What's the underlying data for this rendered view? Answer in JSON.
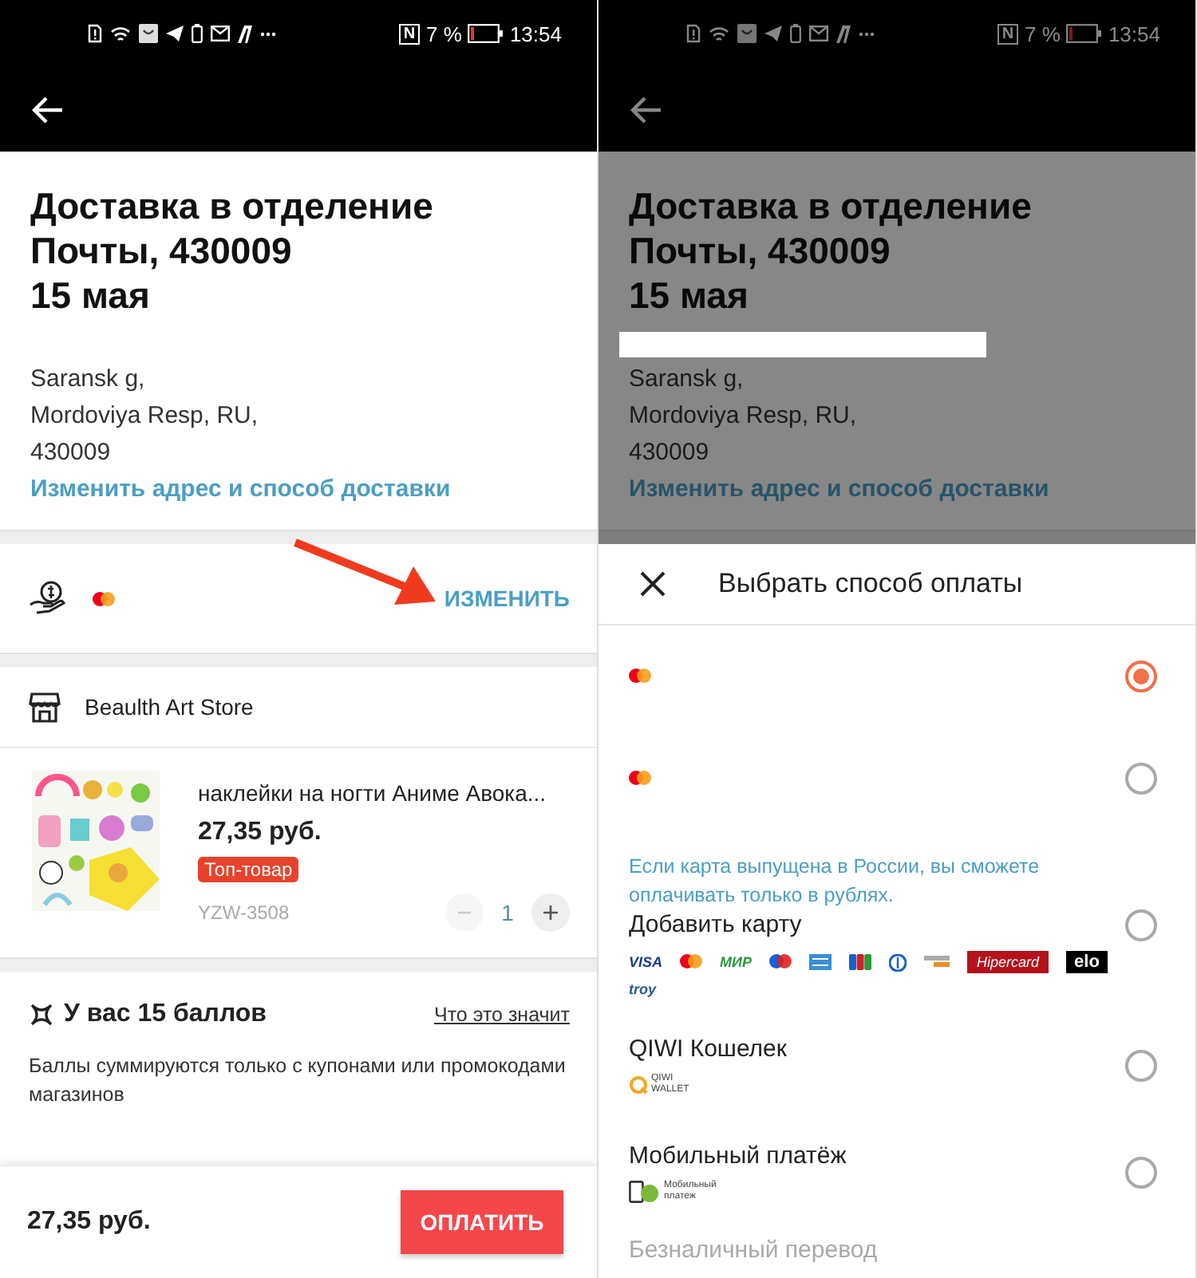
{
  "screens": [
    {
      "status_bar": {
        "nfc": "N",
        "battery": "7 %",
        "time": "13:54"
      },
      "delivery": {
        "title_lines": [
          "Доставка в отделение",
          "Почты, 430009"
        ],
        "date": "15 мая",
        "address": [
          "Saransk g,",
          "Mordoviya Resp, RU,",
          "430009"
        ],
        "change_link": "Изменить адрес и способ доставки"
      },
      "payment": {
        "change_button": "ИЗМЕНИТЬ"
      },
      "store": {
        "name": "Beaulth Art Store"
      },
      "product": {
        "name": "наклейки на ногти Аниме Авока...",
        "price": "27,35 руб.",
        "badge": "Топ-товар",
        "sku": "YZW-3508",
        "quantity": "1"
      },
      "points": {
        "title": "У вас 15 баллов",
        "link": "Что это значит",
        "note": "Баллы суммируются только с купонами или промокодами магазинов"
      },
      "footer": {
        "total": "27,35 руб.",
        "pay_button": "ОПЛАТИТЬ"
      }
    },
    {
      "status_bar": {
        "nfc": "N",
        "battery": "7 %",
        "time": "13:54"
      },
      "dimmed": true,
      "redacted": true,
      "delivery": {
        "title_lines": [
          "Доставка в отделение",
          "Почты, 430009"
        ],
        "date": "15 мая",
        "address": [
          "Saransk g,",
          "Mordoviya Resp, RU,",
          "430009"
        ],
        "change_link": "Изменить адрес и способ доставки"
      },
      "sheet": {
        "title": "Выбрать способ оплаты",
        "options": [
          {
            "kind": "card",
            "selected": true
          },
          {
            "kind": "card",
            "selected": false
          },
          {
            "kind": "add_card",
            "note": "Если карта выпущена в России, вы сможете оплачивать только в рублях.",
            "label": "Добавить карту",
            "selected": false,
            "brands": [
              {
                "kind": "visa",
                "label": "VISA"
              },
              {
                "kind": "mastercard"
              },
              {
                "kind": "mir",
                "label": "МИР"
              },
              {
                "kind": "maestro"
              },
              {
                "kind": "amex"
              },
              {
                "kind": "jcb"
              },
              {
                "kind": "diners"
              },
              {
                "kind": "discover"
              },
              {
                "kind": "hipercard",
                "label": "Hipercard"
              },
              {
                "kind": "elo",
                "label": "elo"
              },
              {
                "kind": "troy",
                "label": "troy"
              }
            ]
          },
          {
            "kind": "wallet",
            "label": "QIWI Кошелек",
            "logo_text": [
              "QIWI",
              "WALLET"
            ],
            "selected": false
          },
          {
            "kind": "mobile",
            "label": "Мобильный платёж",
            "logo_text": [
              "Мобильный",
              "платеж"
            ],
            "selected": false
          },
          {
            "kind": "transfer",
            "label": "Безналичный перевод"
          }
        ]
      }
    }
  ]
}
